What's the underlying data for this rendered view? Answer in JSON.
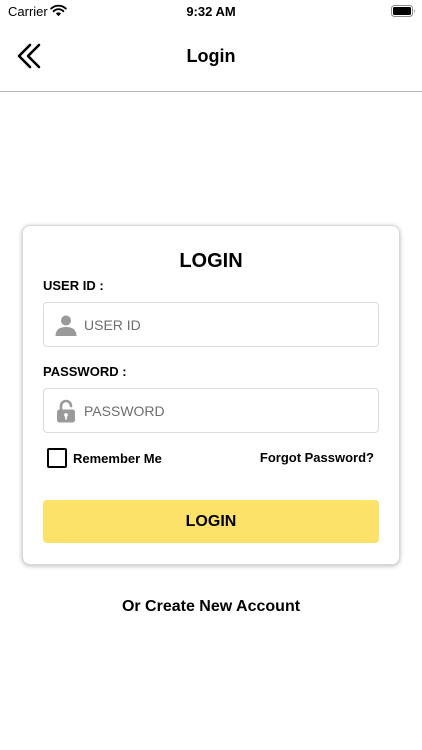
{
  "status_bar": {
    "carrier": "Carrier",
    "time": "9:32 AM"
  },
  "nav": {
    "title": "Login"
  },
  "login_card": {
    "title": "LOGIN",
    "user_id": {
      "label": "USER ID :",
      "placeholder": "USER ID",
      "value": ""
    },
    "password": {
      "label": "PASSWORD :",
      "placeholder": "PASSWORD",
      "value": ""
    },
    "remember_me": {
      "label": "Remember Me",
      "checked": false
    },
    "forgot_password": "Forgot Password?",
    "login_button": "LOGIN"
  },
  "create_account": "Or Create New Account",
  "colors": {
    "accent_yellow": "#fde26a",
    "icon_gray": "#9a9a9a",
    "divider": "#b8b8b8"
  },
  "icons": {
    "back": "double-chevron-left-icon",
    "user": "user-icon",
    "password": "lock-icon",
    "wifi": "wifi-icon",
    "battery": "battery-icon"
  }
}
